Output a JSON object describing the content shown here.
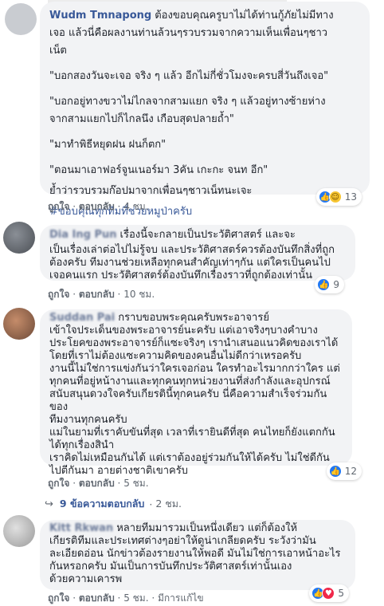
{
  "comments": [
    {
      "name": "Wudm Tmnapong",
      "lines": [
        "ต้องขอบคุณครูบาไม่ได้ท่านกู้ภัยไม่มีทาง",
        "เจอ แล้วนี่คือผลงานท่านล้วนๆรวบรวมจากความเห็นเพื่อนๆชาว",
        "เน็ต"
      ],
      "paragraphs": [
        [
          "\"บอกสองวันจะเจอ จริง ๆ แล้ว อีกไม่กี่ชั่วโมงจะครบสี่วันถึงเจอ\""
        ],
        [
          "\"บอกอยู่ทางขวาไม่ไกลจากสามแยก จริง ๆ แล้วอยู่ทางซ้ายห่าง",
          "จากสามแยกไปก็ไกลนึง เกือบสุดปลายถ้ำ\""
        ],
        [
          "\"มาทำพิธีหยุดฝน ฝนก็ตก\""
        ],
        [
          "\"ตอนมาเอาฟอร์จูนเนอร์มา 3คัน เกะกะ จนท อีก\""
        ],
        [
          "ย้ำว่ารวบรวมก๊อปมาจากเพื่อนๆชาวเน็ทนะเจะ"
        ]
      ],
      "hashtag": "#ขอบคุณทุกทีมที่ช่วยหมูป่าครับ",
      "actions": {
        "like": "ถูกใจ",
        "reply": "ตอบกลับ",
        "time": "4 ชม."
      },
      "reaction_count": "13"
    },
    {
      "name": "Dia Ing Pun",
      "lines": [
        "เรื่องนี้จะกลายเป็นประวัติศาสตร์ และจะ",
        "เป็นเรื่องเล่าต่อไปไม่รู้จบ และประวัติศาสตร์ควรต้องบันทึกสิ่งที่ถูก",
        "ต้องครับ ทีมงานช่วยเหลือทุกคนสำคัญเท่าๆกัน แต่ใครเป็นคนไป",
        "เจอคนแรก ประวัติศาสตร์ต้องบันทึกเรื่องราวที่ถูกต้องเท่านั้น"
      ],
      "actions": {
        "like": "ถูกใจ",
        "reply": "ตอบกลับ",
        "time": "10 ชม."
      },
      "reaction_count": "9"
    },
    {
      "name": "Suddan Pai",
      "lines": [
        "กราบขอบพระคุณครับพระอาจารย์",
        "เข้าใจประเด็นของพระอาจารย์นะครับ แต่เอาจริงๆบางคำบาง",
        "ประโยคของพระอาจารย์ก็แซะจริงๆ เรานำเสนอแนวคิดของเราได้",
        "โดยที่เราไม่ต้องแซะความคิดของคนอื่นไม่ดีกว่าเหรอครับ",
        "งานนี้ไม่ใช่การแข่งกันว่าใครเจอก่อน ใครทำอะไรมากกว่าใคร แต่",
        "ทุกคนที่อยู่หน้างานและทุกคนทุกหน่วยงานที่ส่งกำลังและอุปกรณ์",
        "สนับสนุนดวงใจครับเกียรตินี้ทุกคนครับ นี่คือความสำเร็จร่วมกันของ",
        "ทีมงานทุกคนครับ",
        "แม่ในยามที่เราคับขันที่สุด เวลาที่เรายินดีที่สุด คนไทยก็ยังแตกกัน",
        "ได้ทุกเรื่องสินำ",
        "เราคิดไม่เหมือนกันได้ แต่เราต้องอยู่ร่วมกันให้ได้ครับ ไม่ใช่ดีกัน",
        "ไปตีกันมา อายต่างชาติเขาครับ"
      ],
      "actions": {
        "like": "ถูกใจ",
        "reply": "ตอบกลับ",
        "time": "5 ชม."
      },
      "reaction_count": "12",
      "replies": {
        "text": "9 ข้อความตอบกลับ",
        "time": "2 ชม."
      }
    },
    {
      "name": "Kitt Rkwan",
      "lines": [
        "หลายทีมมารวมเป็นหนึ่งเดียว แต่ก็ต้องให้",
        "เกียรติทีมและประเทศต่างๆอย่าให้ดูน่าเกลียดครับ ระวังว่ามัน",
        "ละเอียดอ่อน นักข่าวต้องรายงานให้พอดี มันไม่ใช่การเอาหน้าอะไร",
        "กันหรอกครับ มันเป็นการบันทึกประวัติศาสตร์เท่านั้นเอง",
        "ด้วยความเคารพ"
      ],
      "actions": {
        "like": "ถูกใจ",
        "reply": "ตอบกลับ",
        "time": "5 ชม.",
        "edited": "มีการแก้ไข"
      },
      "reaction_count": "5"
    }
  ],
  "icons": {
    "like": "like-icon",
    "haha": "haha-icon",
    "love": "love-icon",
    "reply_arrow": "reply-arrow-icon"
  }
}
